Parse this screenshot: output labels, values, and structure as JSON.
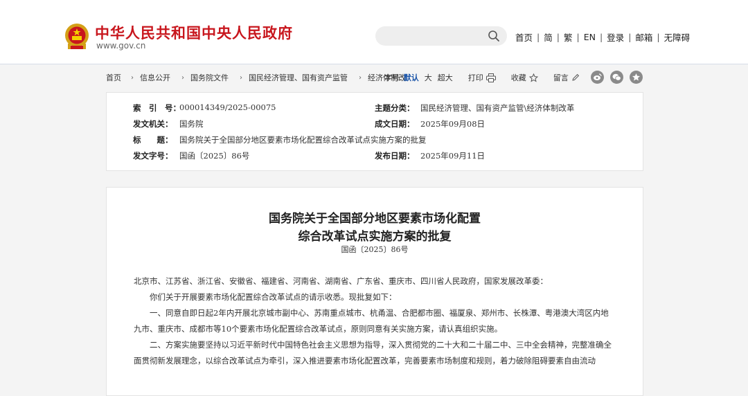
{
  "header": {
    "site_name": "中华人民共和国中央人民政府",
    "site_domain": "www.gov.cn",
    "search_placeholder": "",
    "nav": [
      "首页",
      "简",
      "繁",
      "EN",
      "登录",
      "邮箱",
      "无障碍"
    ]
  },
  "breadcrumb": [
    "首页",
    "信息公开",
    "国务院文件",
    "国民经济管理、国有资产监管",
    "经济体制改"
  ],
  "tools": {
    "font_size_label": "字号:",
    "font_default": "默认",
    "font_large": "大",
    "font_xlarge": "超大",
    "print": "打印",
    "favorite": "收藏",
    "comment": "留言"
  },
  "share_icons": [
    "weibo-icon",
    "wechat-icon",
    "qzone-icon"
  ],
  "info": {
    "index_label": "索　引　号：",
    "index_value": "000014349/2025-00075",
    "category_label": "主题分类：",
    "category_value": "国民经济管理、国有资产监管\\经济体制改革",
    "issuer_label": "发文机关：",
    "issuer_value": "国务院",
    "date_label": "成文日期：",
    "date_value": "2025年09月08日",
    "title_label": "标　　题：",
    "title_value": "国务院关于全国部分地区要素市场化配置综合改革试点实施方案的批复",
    "docno_label": "发文字号：",
    "docno_value": "国函〔2025〕86号",
    "publish_label": "发布日期：",
    "publish_value": "2025年09月11日"
  },
  "document": {
    "title_line1": "国务院关于全国部分地区要素市场化配置",
    "title_line2": "综合改革试点实施方案的批复",
    "number": "国函〔2025〕86号",
    "paragraphs": [
      "北京市、江苏省、浙江省、安徽省、福建省、河南省、湖南省、广东省、重庆市、四川省人民政府，国家发展改革委：",
      "　　你们关于开展要素市场化配置综合改革试点的请示收悉。现批复如下：",
      "　　一、同意自即日起2年内开展北京城市副中心、苏南重点城市、杭甬温、合肥都市圈、福厦泉、郑州市、长株潭、粤港澳大湾区内地九市、重庆市、成都市等10个要素市场化配置综合改革试点，原则同意有关实施方案，请认真组织实施。",
      "　　二、方案实施要坚持以习近平新时代中国特色社会主义思想为指导，深入贯彻党的二十大和二十届二中、三中全会精神，完整准确全面贯彻新发展理念，以综合改革试点为牵引，深入推进要素市场化配置改革，完善要素市场制度和规则，着力破除阻碍要素自由流动"
    ]
  }
}
